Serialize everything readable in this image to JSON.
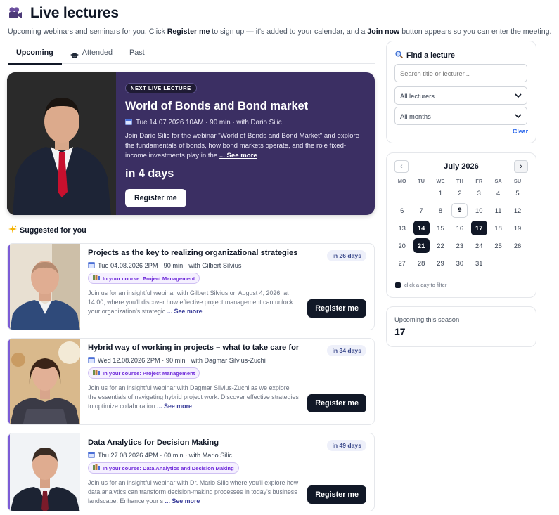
{
  "header": {
    "title": "Live lectures",
    "subtitle_parts": [
      "Upcoming webinars and seminars for you. Click ",
      "Register me",
      " to sign up — it's added to your calendar, and a ",
      "Join now",
      " button appears so you can enter the meeting."
    ]
  },
  "tabs": [
    {
      "label": "Upcoming",
      "icon": null,
      "active": true
    },
    {
      "label": "Attended",
      "icon": "graduation-cap-icon",
      "active": false
    },
    {
      "label": "Past",
      "icon": null,
      "active": false
    }
  ],
  "hero": {
    "badge": "NEXT LIVE LECTURE",
    "title": "World of Bonds and Bond market",
    "meta": "Tue 14.07.2026 10AM · 90 min · with Dario Silic",
    "description": "Join Dario Silic for the webinar \"World of Bonds and Bond Market\" and explore the fundamentals of bonds, how bond markets operate, and the role fixed-income investments play in the ",
    "see_more": "... See more",
    "countdown": "in 4 days",
    "button": "Register me"
  },
  "suggested": {
    "heading": "Suggested for you",
    "cards": [
      {
        "title": "Projects as the key to realizing organizational strategies",
        "meta": "Tue 04.08.2026 2PM · 90 min · with Gilbert Silvius",
        "course": "In your course: Project Management",
        "description": "Join us for an insightful webinar with Gilbert Silvius on August 4, 2026, at 14:00, where you'll discover how effective project management can unlock your organization's strategic ",
        "see_more": "... See more",
        "days": "in 26 days",
        "button": "Register me"
      },
      {
        "title": "Hybrid way of working in projects – what to take care for",
        "meta": "Wed 12.08.2026 2PM · 90 min · with Dagmar Silvius-Zuchi",
        "course": "In your course: Project Management",
        "description": "Join us for an insightful webinar with Dagmar Silvius-Zuchi as we explore the essentials of navigating hybrid project work. Discover effective strategies to optimize collaboration ",
        "see_more": "... See more",
        "days": "in 34 days",
        "button": "Register me"
      },
      {
        "title": "Data Analytics for Decision Making",
        "meta": "Thu 27.08.2026 4PM · 60 min · with Mario Silic",
        "course": "In your course: Data Analytics and Decision Making",
        "description": "Join us for an insightful webinar with Dr. Mario Silic where you'll explore how data analytics can transform decision-making processes in today's business landscape. Enhance your s ",
        "see_more": "... See more",
        "days": "in 49 days",
        "button": "Register me"
      }
    ]
  },
  "finder": {
    "title": "Find a lecture",
    "search_placeholder": "Search title or lecturer...",
    "lecturer_select": "All lecturers",
    "month_select": "All months",
    "clear": "Clear"
  },
  "calendar": {
    "month": "July 2026",
    "prev": "‹",
    "next": "›",
    "dow": [
      "MO",
      "TU",
      "WE",
      "TH",
      "FR",
      "SA",
      "SU"
    ],
    "weeks": [
      [
        "",
        "",
        "1",
        "2",
        "3",
        "4",
        "5"
      ],
      [
        "6",
        "7",
        "8",
        "9",
        "10",
        "11",
        "12"
      ],
      [
        "13",
        "14",
        "15",
        "16",
        "17",
        "18",
        "19"
      ],
      [
        "20",
        "21",
        "22",
        "23",
        "24",
        "25",
        "26"
      ],
      [
        "27",
        "28",
        "29",
        "30",
        "31",
        "",
        ""
      ]
    ],
    "today": "9",
    "event_days": [
      "14",
      "17",
      "21"
    ],
    "hint": "click a day to filter"
  },
  "season": {
    "label": "Upcoming this season",
    "count": "17"
  },
  "colors": {
    "hero_bg": "#3b2f63",
    "accent": "#7c5cd6",
    "button_dark": "#111827",
    "link_blue": "#2563eb"
  }
}
